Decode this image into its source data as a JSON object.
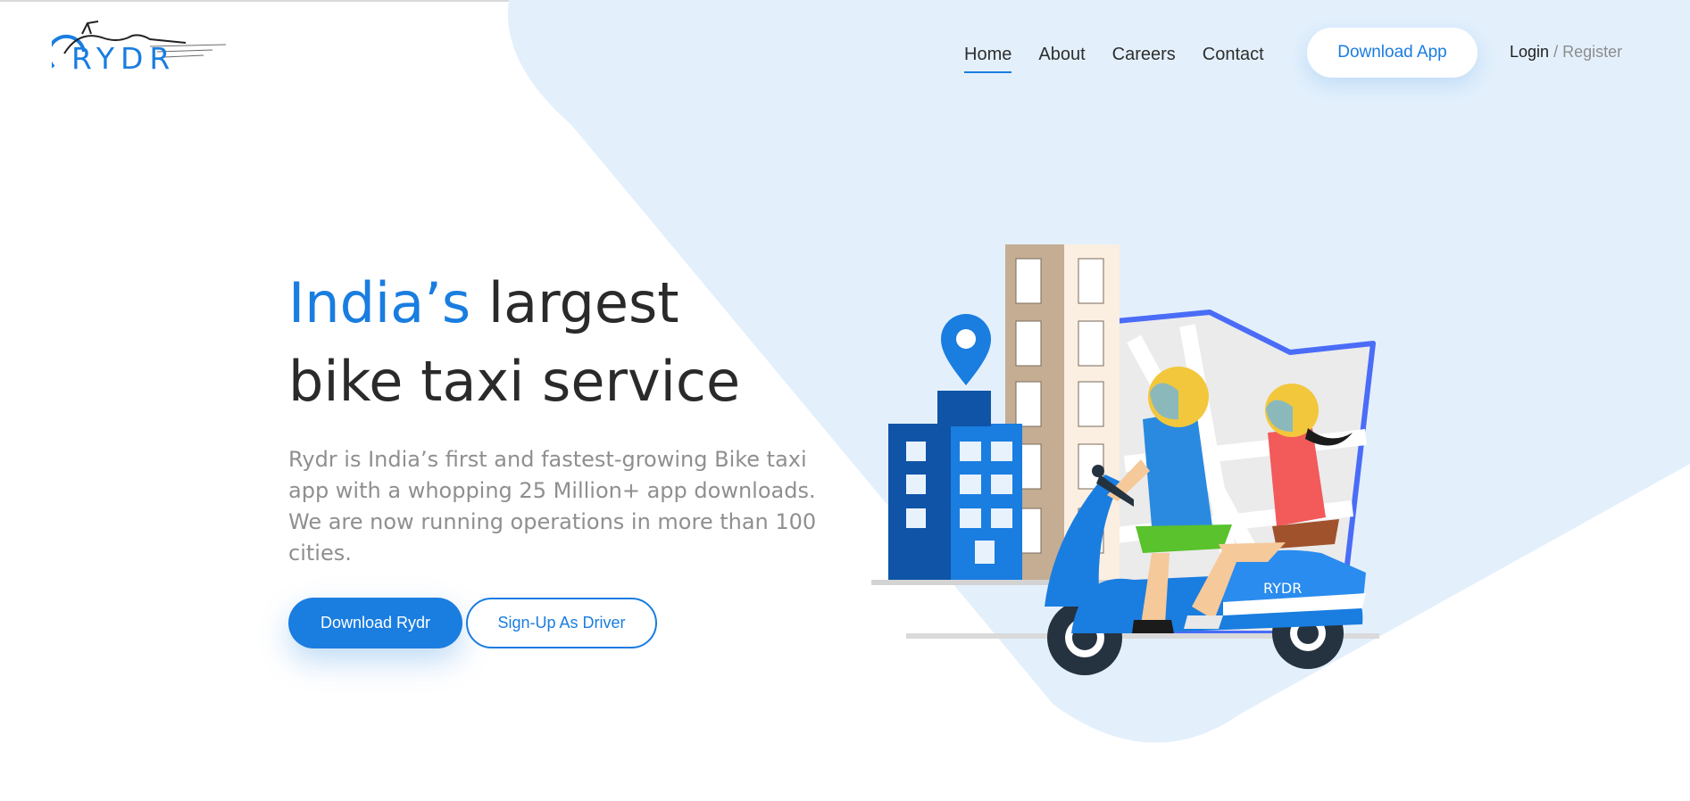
{
  "brand": {
    "logo_text": "RYDR"
  },
  "nav": {
    "items": [
      {
        "label": "Home",
        "active": true
      },
      {
        "label": "About",
        "active": false
      },
      {
        "label": "Careers",
        "active": false
      },
      {
        "label": "Contact",
        "active": false
      }
    ],
    "download_app": "Download App",
    "login": "Login",
    "separator": "/",
    "register": "Register"
  },
  "hero": {
    "title_accent": "India’s",
    "title_rest_line1": "largest",
    "title_line2": "bike taxi service",
    "description": "Rydr is India’s first and fastest-growing Bike taxi app with a whopping 25 Million+ app downloads. We are now running operations in more than 100 cities.",
    "primary_button": "Download Rydr",
    "secondary_button": "Sign-Up As Driver"
  },
  "illustration": {
    "scooter_label": "RYDR"
  },
  "colors": {
    "accent": "#1a7de0",
    "background_shape": "#e3f0fc",
    "text_dark": "#2a2a2a",
    "text_muted": "#8f8f8f"
  }
}
